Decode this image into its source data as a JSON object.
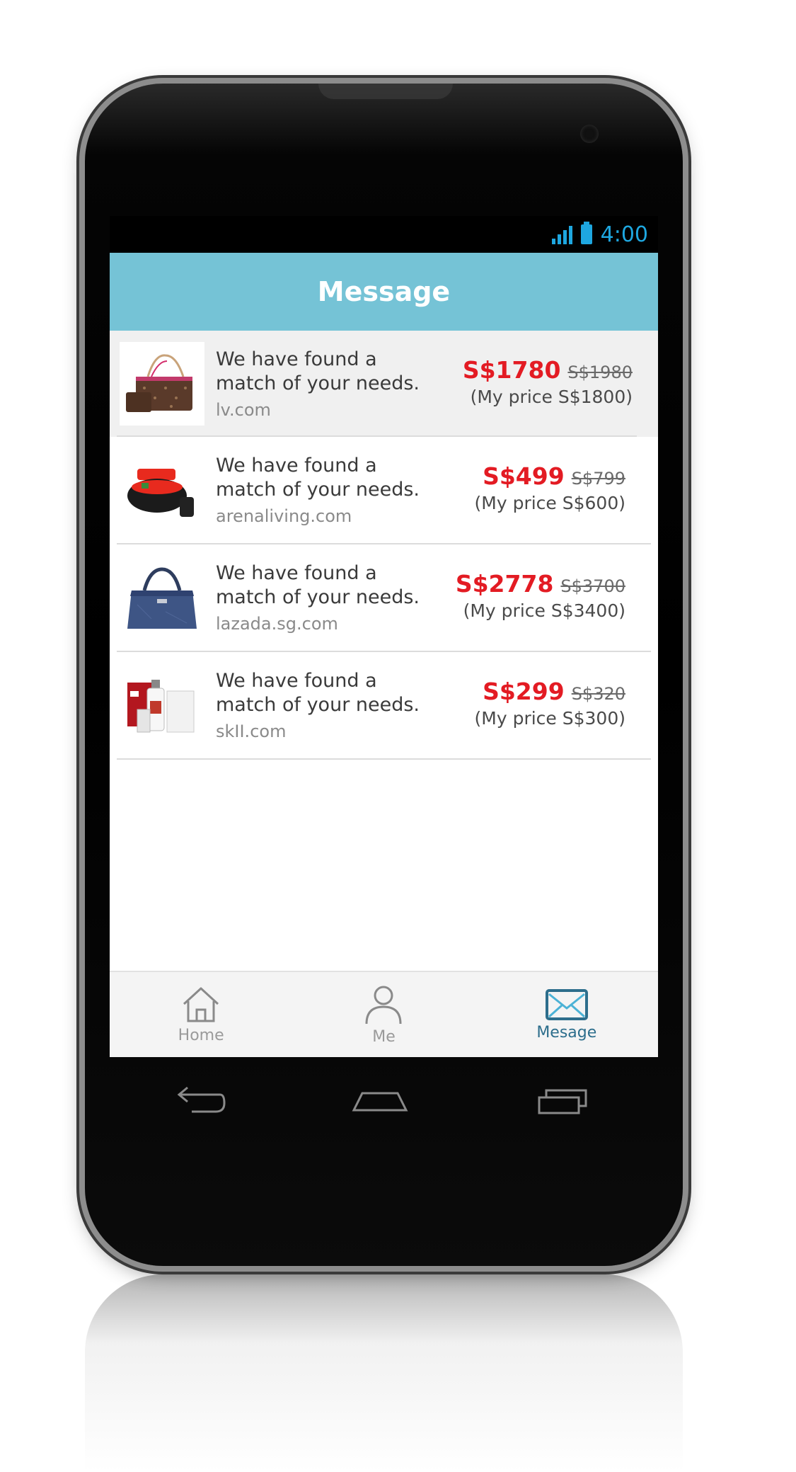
{
  "status": {
    "time": "4:00"
  },
  "header": {
    "title": "Message"
  },
  "messages": [
    {
      "text": "We have found a match of your needs.",
      "source": "lv.com",
      "price": "S$1780",
      "old_price": "S$1980",
      "my_price": "(My price S$1800)",
      "icon": "handbag-product-image"
    },
    {
      "text": "We have found a match of your needs.",
      "source": "arenaliving.com",
      "price": "S$499",
      "old_price": "S$799",
      "my_price": "(My price S$600)",
      "icon": "outdoor-daybed-product-image"
    },
    {
      "text": "We have found a match of your needs.",
      "source": "lazada.sg.com",
      "price": "S$2778",
      "old_price": "S$3700",
      "my_price": "(My price S$3400)",
      "icon": "blue-tote-product-image"
    },
    {
      "text": "We have found a match of your needs.",
      "source": "skII.com",
      "price": "S$299",
      "old_price": "S$320",
      "my_price": "(My price S$300)",
      "icon": "skincare-set-product-image"
    }
  ],
  "tabs": [
    {
      "label": "Home",
      "icon": "home-icon"
    },
    {
      "label": "Me",
      "icon": "user-icon"
    },
    {
      "label": "Mesage",
      "icon": "mail-icon"
    }
  ],
  "colors": {
    "header": "#75c3d6",
    "price": "#e31b23",
    "status": "#1ea7e0",
    "active_tab": "#2d6e8c"
  }
}
